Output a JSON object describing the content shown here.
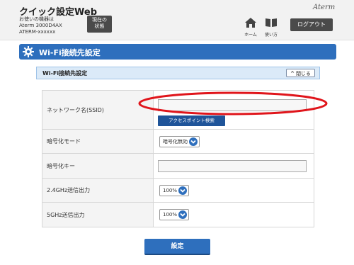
{
  "header": {
    "app_title": "クイック設定Web",
    "device_line1": "お使いの機器は",
    "device_line2": "Aterm 3000D4AX",
    "device_line3": "ATERM-xxxxxx",
    "status_button_line1": "現在の",
    "status_button_line2": "状態",
    "brand": "Aterm",
    "home_label": "ホーム",
    "howto_label": "使い方",
    "logout_label": "ログアウト"
  },
  "section": {
    "title": "Wi-Fi接続先設定",
    "sub_title": "Wi-Fi接続先設定",
    "close_label": "閉じる"
  },
  "form": {
    "ssid_label": "ネットワーク名(SSID)",
    "ssid_value": "",
    "ap_search_label": "アクセスポイント検索",
    "encryption_label": "暗号化モード",
    "encryption_value": "暗号化無効",
    "key_label": "暗号化キー",
    "key_value": "",
    "power24_label": "2.4GHz送信出力",
    "power24_value": "100%",
    "power5_label": "5GHz送信出力",
    "power5_value": "100%",
    "submit_label": "設定"
  },
  "colors": {
    "accent": "#2e6fbd",
    "annotation": "#e0151b"
  }
}
